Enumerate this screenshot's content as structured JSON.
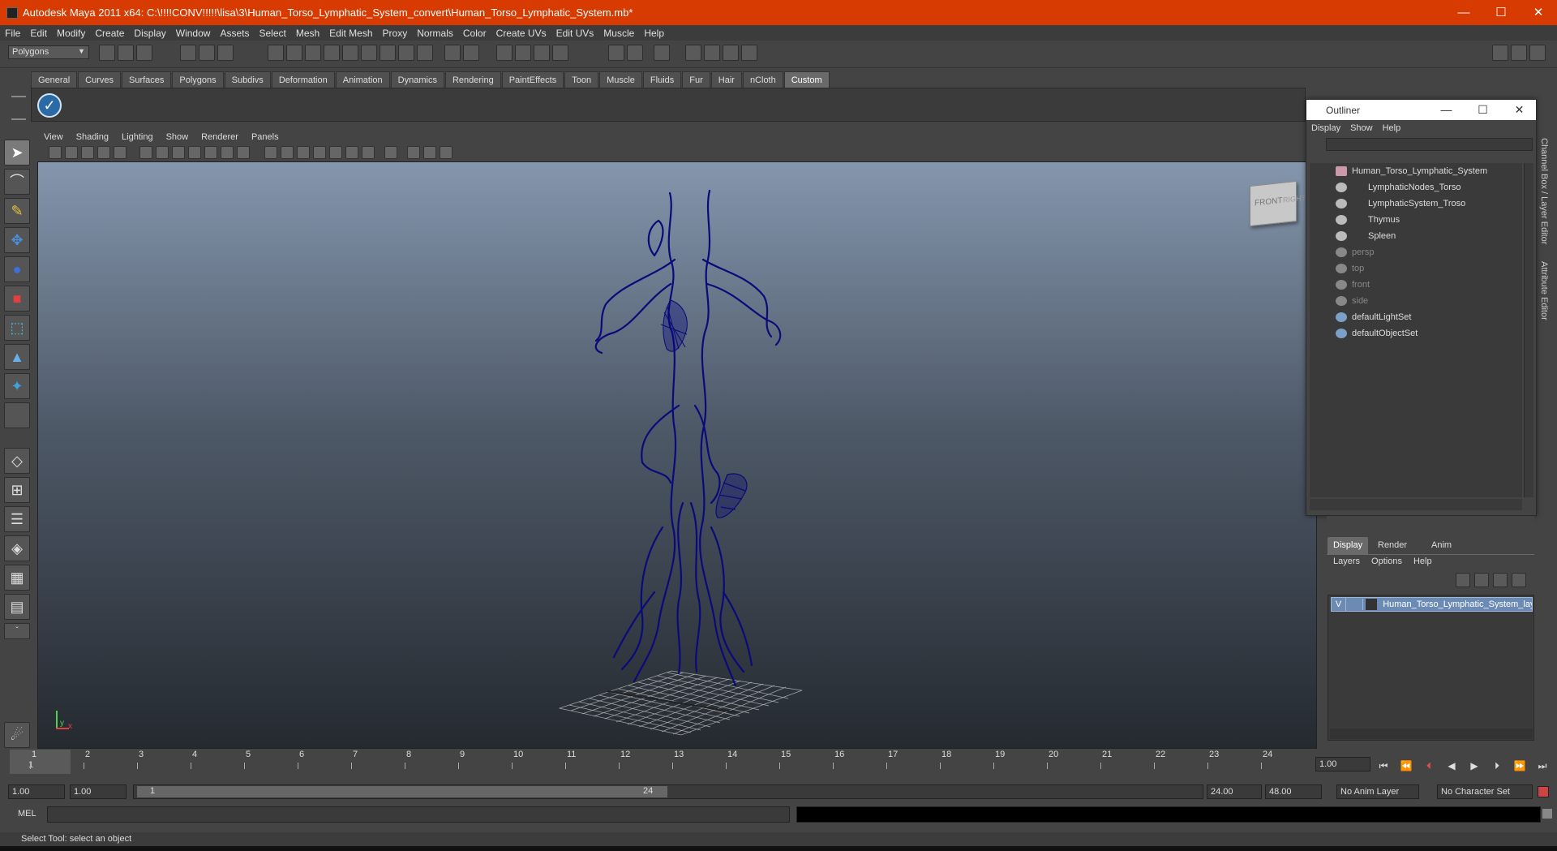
{
  "window": {
    "title": "Autodesk Maya 2011 x64: C:\\!!!!CONV!!!!!\\lisa\\3\\Human_Torso_Lymphatic_System_convert\\Human_Torso_Lymphatic_System.mb*",
    "minimize": "—",
    "maximize": "☐",
    "close": "✕"
  },
  "menubar": [
    "File",
    "Edit",
    "Modify",
    "Create",
    "Display",
    "Window",
    "Assets",
    "Select",
    "Mesh",
    "Edit Mesh",
    "Proxy",
    "Normals",
    "Color",
    "Create UVs",
    "Edit UVs",
    "Muscle",
    "Help"
  ],
  "statusline": {
    "mode": "Polygons"
  },
  "shelf": {
    "tabs": [
      "General",
      "Curves",
      "Surfaces",
      "Polygons",
      "Subdivs",
      "Deformation",
      "Animation",
      "Dynamics",
      "Rendering",
      "PaintEffects",
      "Toon",
      "Muscle",
      "Fluids",
      "Fur",
      "Hair",
      "nCloth",
      "Custom"
    ],
    "active": "Custom"
  },
  "panel": {
    "menu": [
      "View",
      "Shading",
      "Lighting",
      "Show",
      "Renderer",
      "Panels"
    ],
    "viewcube": {
      "front": "FRONT",
      "right": "RIGHT"
    },
    "axis": {
      "y": "y",
      "x": "x"
    }
  },
  "outliner": {
    "title": "Outliner",
    "menu": [
      "Display",
      "Show",
      "Help"
    ],
    "items": [
      {
        "label": "Human_Torso_Lymphatic_System",
        "indent": 0,
        "dim": false
      },
      {
        "label": "LymphaticNodes_Torso",
        "indent": 1,
        "dim": false
      },
      {
        "label": "LymphaticSystem_Troso",
        "indent": 1,
        "dim": false
      },
      {
        "label": "Thymus",
        "indent": 1,
        "dim": false
      },
      {
        "label": "Spleen",
        "indent": 1,
        "dim": false
      },
      {
        "label": "persp",
        "indent": 0,
        "dim": true
      },
      {
        "label": "top",
        "indent": 0,
        "dim": true
      },
      {
        "label": "front",
        "indent": 0,
        "dim": true
      },
      {
        "label": "side",
        "indent": 0,
        "dim": true
      },
      {
        "label": "defaultLightSet",
        "indent": 0,
        "dim": false
      },
      {
        "label": "defaultObjectSet",
        "indent": 0,
        "dim": false
      }
    ]
  },
  "layers": {
    "tabs": [
      "Display",
      "Render",
      "Anim"
    ],
    "active": "Display",
    "menu": [
      "Layers",
      "Options",
      "Help"
    ],
    "row": {
      "visible": "V",
      "name": "Human_Torso_Lymphatic_System_layer"
    }
  },
  "sidetabs": [
    "Channel Box / Layer Editor",
    "Attribute Editor"
  ],
  "timeline": {
    "ticks": [
      "1",
      "2",
      "3",
      "4",
      "5",
      "6",
      "7",
      "8",
      "9",
      "10",
      "11",
      "12",
      "13",
      "14",
      "15",
      "16",
      "17",
      "18",
      "19",
      "20",
      "21",
      "22",
      "23",
      "24"
    ],
    "current": "1",
    "current_frame_field": "1.00"
  },
  "range": {
    "start": "1.00",
    "playback_start": "1.00",
    "slider_start": "1",
    "slider_end": "24",
    "playback_end": "24.00",
    "end": "48.00",
    "anim_layer": "No Anim Layer",
    "character_set": "No Character Set"
  },
  "cmdline": {
    "label": "MEL"
  },
  "helpline": {
    "text": "Select Tool: select an object"
  },
  "colors": {
    "titlebar": "#d83b01",
    "wireframe": "#0a0a7a",
    "selection": "#6b8bb5"
  }
}
